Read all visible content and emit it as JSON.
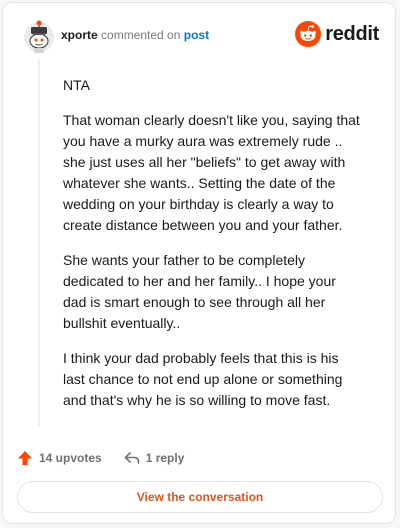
{
  "header": {
    "username": "xporte",
    "commented_text": "commented on",
    "post_link": "post",
    "brand": "reddit"
  },
  "comment": {
    "paragraphs": [
      "NTA",
      "That woman clearly doesn't like you, saying that you have a murky aura was extremely rude .. she just uses all her \"beliefs\" to get away with whatever she wants.. Setting the date of the wedding on your birthday is clearly a way to create distance between you and your father.",
      "She wants your father to be completely dedicated to her and her family.. I hope your dad is smart enough to see through all her bullshit eventually..",
      "I think your dad probably feels that this is his last chance to not end up alone or something and that's why he is so willing to move fast."
    ]
  },
  "actions": {
    "upvotes_label": "14 upvotes",
    "replies_label": "1 reply"
  },
  "footer": {
    "view_button_label": "View the conversation"
  },
  "colors": {
    "brand": "#ff4500",
    "upvote": "#ff4500",
    "link": "#0079d3",
    "view_button_text": "#e0541c"
  },
  "icons": {
    "avatar": "snoo-avatar",
    "brand": "reddit-logo-icon",
    "upvote": "upvote-arrow-icon",
    "reply": "reply-arrow-icon"
  }
}
